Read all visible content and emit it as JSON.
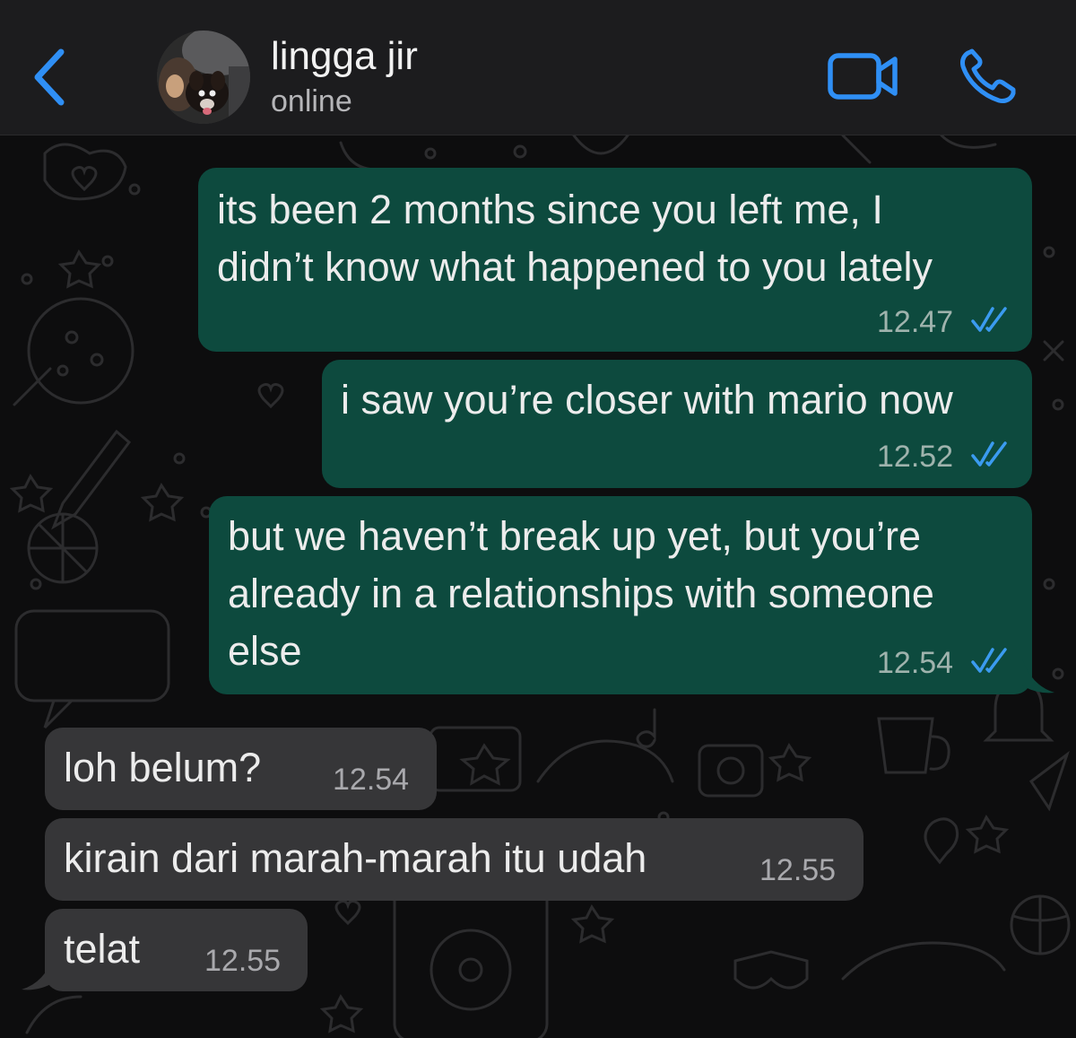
{
  "header": {
    "contact_name": "lingga jir",
    "status": "online",
    "back_icon": "chevron-left-icon",
    "video_icon": "video-camera-icon",
    "call_icon": "phone-icon",
    "accent_color": "#2f8ff5"
  },
  "messages": [
    {
      "direction": "outgoing",
      "lines": [
        "its been 2 months since you left me, I",
        "didn’t know what happened to you lately"
      ],
      "time": "12.47",
      "status": "read"
    },
    {
      "direction": "outgoing",
      "lines": [
        "i saw you’re closer with mario now"
      ],
      "time": "12.52",
      "status": "read"
    },
    {
      "direction": "outgoing",
      "lines": [
        "but we haven’t break up yet, but you’re",
        "already in a relationships with someone",
        "else"
      ],
      "time": "12.54",
      "status": "read"
    },
    {
      "direction": "incoming",
      "lines": [
        "loh belum?"
      ],
      "time": "12.54"
    },
    {
      "direction": "incoming",
      "lines": [
        "kirain dari marah-marah itu udah"
      ],
      "time": "12.55"
    },
    {
      "direction": "incoming",
      "lines": [
        "telat"
      ],
      "time": "12.55"
    }
  ],
  "colors": {
    "outgoing_bubble": "#0d4a3e",
    "incoming_bubble": "#363638",
    "read_ticks": "#3b9bf0",
    "chat_background": "#0d0d0e"
  }
}
